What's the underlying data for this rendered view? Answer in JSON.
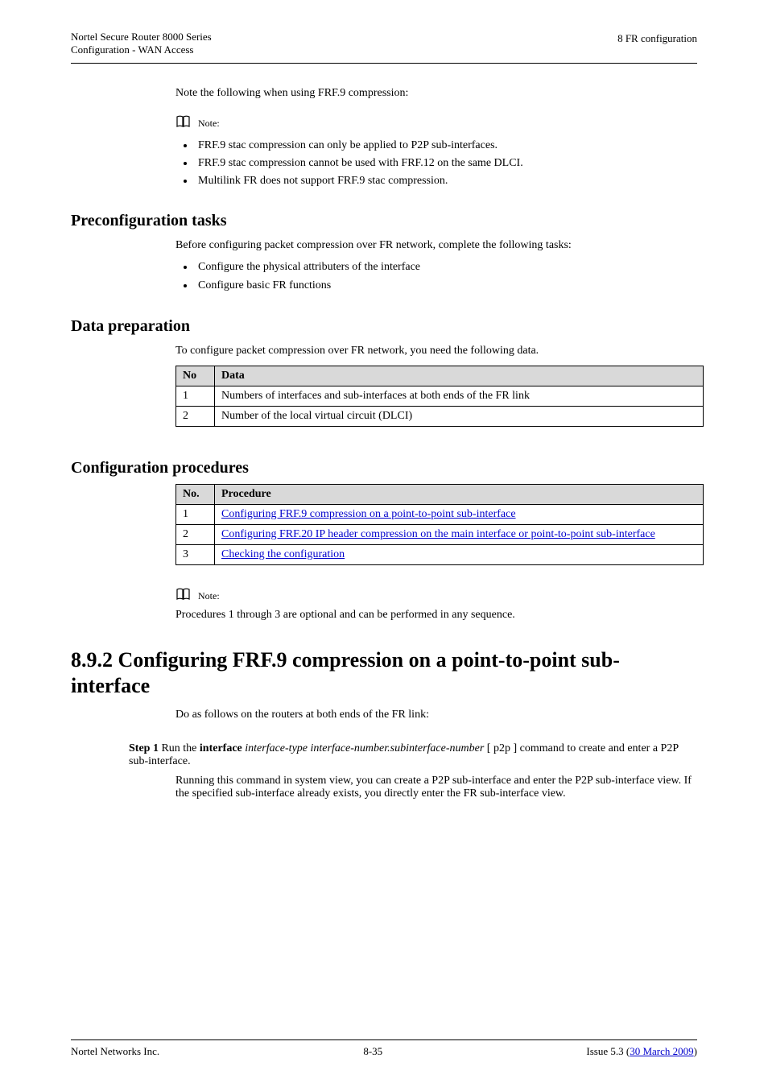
{
  "header": {
    "left_line1": "Nortel Secure Router 8000 Series",
    "left_line2": "Configuration - WAN Access",
    "right_line1": "8 FR configuration"
  },
  "intro": {
    "sentence": "Note the following when using FRF.9 compression:",
    "note_label": "Note:",
    "notes": [
      "FRF.9 stac compression can only be applied to P2P sub-interfaces.",
      "FRF.9 stac compression cannot be used with FRF.12 on the same DLCI.",
      "Multilink FR does not support FRF.9 stac compression."
    ]
  },
  "preconfig": {
    "heading": "Preconfiguration tasks",
    "para": "Before configuring packet compression over FR network, complete the following tasks:",
    "items": [
      "Configure the physical attributers of the interface",
      "Configure basic FR functions"
    ]
  },
  "dataprep": {
    "heading": "Data preparation",
    "para": "To configure packet compression over FR network, you need the following data.",
    "col_no": "No",
    "col_data": "Data",
    "rows": [
      {
        "no": "1",
        "data": "Numbers of interfaces and sub-interfaces at both ends of the FR link"
      },
      {
        "no": "2",
        "data": "Number of the local virtual circuit (DLCI)"
      }
    ]
  },
  "confproc": {
    "heading": "Configuration procedures",
    "col_no": "No.",
    "col_proc": "Procedure",
    "rows": [
      {
        "no": "1",
        "proc_a": "Configuring FRF.9 compression on a point-to-point sub-interface"
      },
      {
        "no": "2",
        "proc_a": "Configuring FRF.20 IP header compression on the main interface or point-to-point sub-interface"
      },
      {
        "no": "3",
        "proc_a": "Checking the configuration"
      }
    ],
    "note_label": "Note:",
    "note_text": "Procedures 1 through 3 are optional and can be performed in any sequence."
  },
  "section892": {
    "heading": "8.9.2 Configuring FRF.9 compression on a point-to-point sub-interface",
    "step_prefix": "Do as follows on the routers at both ends of the FR link:",
    "step1_label": "Step 1",
    "step1_text": " Run the ",
    "step1_cmd": "interface",
    "step1_arg": " interface-type interface-number.subinterface-number",
    "step1_suffix": " [ p2p ] command to create and enter a P2P sub-interface.",
    "step1_running": "Running this command in system view, you can create a P2P sub-interface and enter the P2P sub-interface view. If the specified sub-interface already exists, you directly enter the FR sub-interface view."
  },
  "footer": {
    "left": "Nortel Networks Inc.",
    "center": "8-35",
    "right_prefix": "Issue 5.3 (",
    "right_date": "30 March 2009",
    "right_suffix": ")"
  }
}
